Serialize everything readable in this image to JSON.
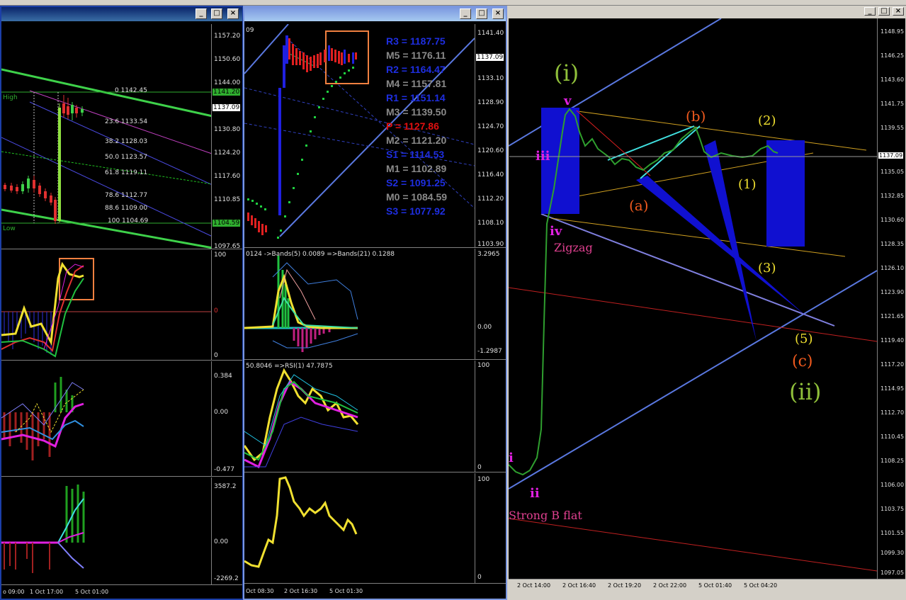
{
  "left_window": {
    "price_labels": [
      "1157.20",
      "1150.60",
      "1144.00",
      "1137.09",
      "1130.80",
      "1124.20",
      "1117.60",
      "1110.85",
      "1104.59",
      "1097.65"
    ],
    "current_price": "1137.09",
    "high_tag": "1141.20",
    "low_tag": "1104.59",
    "high_label": "High",
    "low_label": "Low",
    "fib_levels": [
      "0 1142.45",
      "23.6 1133.54",
      "38.2 1128.03",
      "50.0 1123.57",
      "61.8 1119.11",
      "78.6 1112.77",
      "88.6 1109.00",
      "100 1104.69"
    ],
    "osc1": {
      "top": "100",
      "mid": "0",
      "bottom": "0"
    },
    "osc2": {
      "top": "0.384",
      "mid": "0.00",
      "bottom": "-0.477"
    },
    "osc3": {
      "top": "3587.2",
      "mid": "0.00",
      "bottom": "-2269.2"
    },
    "time_labels": [
      "o 09:00",
      "1 Oct 17:00",
      "5 Oct 01:00"
    ]
  },
  "mid_window": {
    "corner_label": "09",
    "price_labels": [
      "1141.40",
      "1137.09",
      "1133.10",
      "1128.90",
      "1124.70",
      "1120.60",
      "1116.40",
      "1112.20",
      "1108.10",
      "1103.90"
    ],
    "current_price": "1137.09",
    "pivots": [
      {
        "text": "R3 = 1187.75",
        "color": "#1e2ee0"
      },
      {
        "text": "M5 = 1176.11",
        "color": "#8a8a8a"
      },
      {
        "text": "R2 = 1164.47",
        "color": "#1e2ee0"
      },
      {
        "text": "M4 = 1157.81",
        "color": "#8a8a8a"
      },
      {
        "text": "R1 = 1151.14",
        "color": "#1e2ee0"
      },
      {
        "text": "M3 = 1139.50",
        "color": "#8a8a8a"
      },
      {
        "text": "P  = 1127.86",
        "color": "#e01010"
      },
      {
        "text": "M2 = 1121.20",
        "color": "#8a8a8a"
      },
      {
        "text": "S1 = 1114.53",
        "color": "#1e2ee0"
      },
      {
        "text": "M1 = 1102.89",
        "color": "#8a8a8a"
      },
      {
        "text": "S2 = 1091.25",
        "color": "#1e2ee0"
      },
      {
        "text": "M0 = 1084.59",
        "color": "#8a8a8a"
      },
      {
        "text": "S3 = 1077.92",
        "color": "#1e2ee0"
      }
    ],
    "osc1_header": "0124  ->Bands(5) 0.0089  =>Bands(21) 0.1288",
    "osc1": {
      "top": "3.2965",
      "mid": "0.00",
      "bottom": "-1.2987"
    },
    "osc2_header": "50.8046    =>RSI(1) 47.7875",
    "osc2": {
      "top": "100",
      "bottom": "0"
    },
    "osc3": {
      "top": "100",
      "bottom": "0"
    },
    "time_labels": [
      "Oct 08:30",
      "2 Oct 16:30",
      "5 Oct 01:30"
    ]
  },
  "right_window": {
    "price_labels": [
      "1148.95",
      "1146.25",
      "1143.60",
      "1141.75",
      "1139.55",
      "1137.09",
      "1135.05",
      "1132.85",
      "1130.60",
      "1128.35",
      "1126.10",
      "1123.90",
      "1121.65",
      "1119.40",
      "1117.20",
      "1114.95",
      "1112.70",
      "1110.45",
      "1108.25",
      "1106.00",
      "1103.75",
      "1101.55",
      "1099.30",
      "1097.05"
    ],
    "current_price": "1137.09",
    "time_labels": [
      "2 Oct 14:00",
      "2 Oct 16:40",
      "2 Oct 19:20",
      "2 Oct 22:00",
      "5 Oct 01:40",
      "5 Oct 04:20"
    ],
    "waves": {
      "i_big": "(i)",
      "ii_big": "(ii)",
      "v": "v",
      "iii": "iii",
      "iv": "iv",
      "i_small": "i",
      "ii_small": "ii",
      "zigzag": "Zigzag",
      "strong_b_flat": "Strong B flat",
      "a": "(a)",
      "b": "(b)",
      "c": "(c)",
      "w1": "(1)",
      "w2": "(2)",
      "w3": "(3)",
      "w5": "(5)"
    },
    "colors": {
      "green_wave": "#8fbf3a",
      "magenta": "#e020e0",
      "orange": "#f05a1e",
      "yellow": "#f0e030",
      "pink": "#e04090"
    }
  }
}
